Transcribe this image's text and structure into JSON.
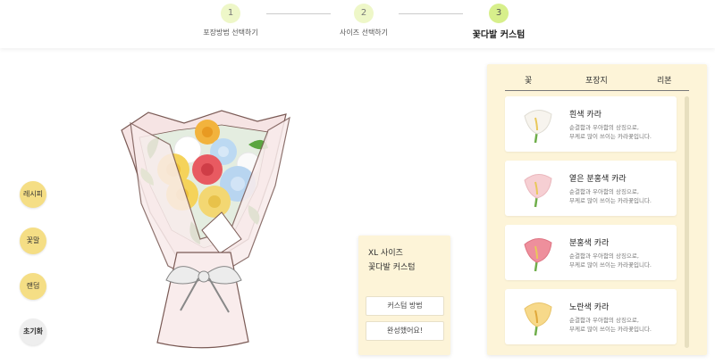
{
  "stepper": {
    "steps": [
      {
        "number": "1",
        "label": "포장방법 선택하기"
      },
      {
        "number": "2",
        "label": "사이즈 선택하기"
      },
      {
        "number": "3",
        "label": "꽃다발 커스텀"
      }
    ],
    "active_step": 3
  },
  "side_buttons": {
    "recipe": "레시피",
    "flower_language": "꽃말",
    "random": "랜덤",
    "reset": "초기화"
  },
  "info_card": {
    "size_line": "XL 사이즈",
    "title_line": "꽃다발 커스텀",
    "how_to_button": "커스텀 방법",
    "done_button": "완성했어요!"
  },
  "panel": {
    "tabs": [
      "꽃",
      "포장지",
      "리본"
    ],
    "items": [
      {
        "name": "흰색 카라",
        "desc_line1": "순결함과 우아함의 상징으로,",
        "desc_line2": "부케로 많이 쓰이는 카라꽃입니다.",
        "color": "#f7f4ee"
      },
      {
        "name": "옅은 분홍색 카라",
        "desc_line1": "순결함과 우아함의 상징으로,",
        "desc_line2": "부케로 많이 쓰이는 카라꽃입니다.",
        "color": "#f6cfd3"
      },
      {
        "name": "분홍색 카라",
        "desc_line1": "순결함과 우아함의 상징으로,",
        "desc_line2": "부케로 많이 쓰이는 카라꽃입니다.",
        "color": "#ee8f9c"
      },
      {
        "name": "노란색 카라",
        "desc_line1": "순결함과 우아함의 상징으로,",
        "desc_line2": "부케로 많이 쓰이는 카라꽃입니다.",
        "color": "#f7d98a"
      }
    ]
  },
  "colors": {
    "accent_yellow": "#f5de85",
    "panel_bg": "#fdf4d8",
    "step_active": "#d7ef8b",
    "step_inactive": "#eef7c8"
  }
}
